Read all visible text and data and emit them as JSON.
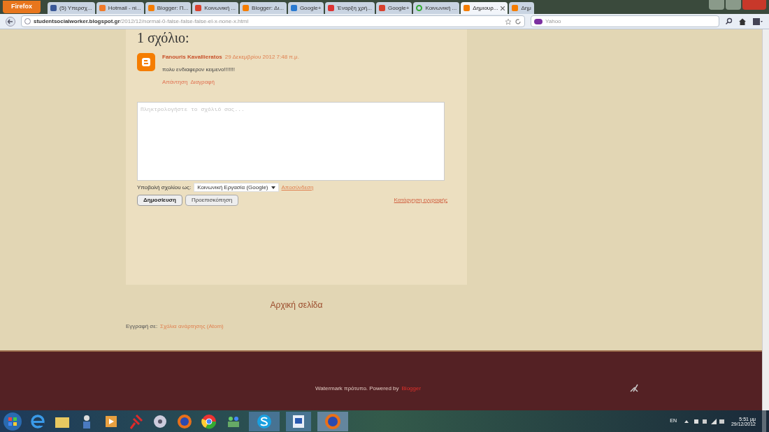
{
  "browser": {
    "menu_button": "Firefox",
    "tabs": [
      {
        "title": "(5) Υπερσχ...",
        "kind": "facebook",
        "selected": false
      },
      {
        "title": "Hotmail - ni...",
        "kind": "hotmail",
        "selected": false
      },
      {
        "title": "Blogger: Π...",
        "kind": "blogger",
        "selected": false
      },
      {
        "title": "Κοινωνική ...",
        "kind": "google",
        "selected": false
      },
      {
        "title": "Blogger: Δι...",
        "kind": "blogger",
        "selected": false
      },
      {
        "title": "Google+",
        "kind": "blue",
        "selected": false
      },
      {
        "title": "Έναρξη χρή...",
        "kind": "gmail",
        "selected": false
      },
      {
        "title": "Google+",
        "kind": "google",
        "selected": false
      },
      {
        "title": "Κοινωνική ...",
        "kind": "loading",
        "selected": false
      },
      {
        "title": "Δημιουρ...",
        "kind": "blogger",
        "selected": true
      },
      {
        "title": "Δημ",
        "kind": "blogger",
        "selected": false
      }
    ],
    "url_host": "studentsocialworker.blogspot.gr",
    "url_path": "/2012/12/normal-0-false-false-false-el-x-none-x.html",
    "search_placeholder": "Yahoo"
  },
  "comments": {
    "heading": "1 σχόλιο:",
    "items": [
      {
        "author": "Fanouris Kavallieratos",
        "date": "29 Δεκεμβρίου 2012 7:48 π.μ.",
        "text": "πολυ ενδιαφερον κειμενο!!!!!!!",
        "actions": [
          "Απάντηση",
          "Διαγραφή"
        ]
      }
    ],
    "form": {
      "placeholder": "Πληκτρολογήστε το σχόλιό σας...",
      "post_as_label": "Υποβολή σχολίου ως:",
      "identity": "Κοινωνική Εργασία (Google)",
      "sign_out": "Αποσύνδεση",
      "buttons": [
        "Δημοσίευση",
        "Προεπισκόπηση"
      ],
      "unsubscribe": "Κατάργηση εγγραφής"
    }
  },
  "home_link": "Αρχική σελίδα",
  "subscribe": {
    "label": "Εγγραφή σε:",
    "link": "Σχόλια ανάρτησης (Atom)"
  },
  "footer": {
    "text": "Watermark πρότυπο. Powered by",
    "link": "Blogger"
  },
  "taskbar": {
    "language": "EN",
    "time": "5:51 μμ",
    "date": "29/12/2012"
  }
}
